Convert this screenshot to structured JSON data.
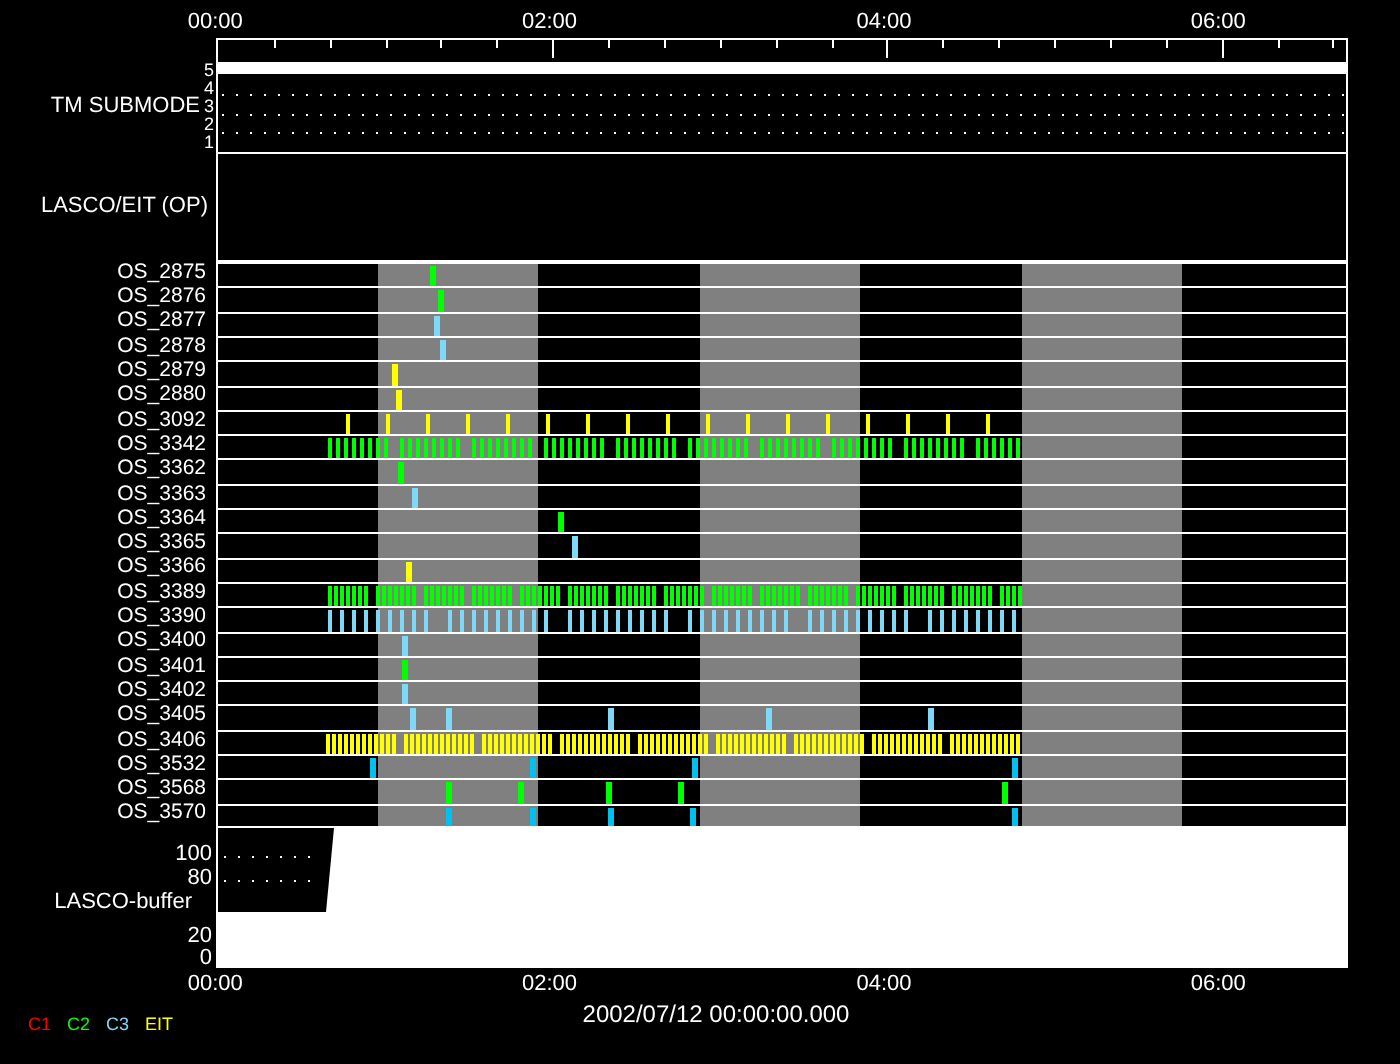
{
  "time_axis_top": [
    "00:00",
    "02:00",
    "04:00",
    "06:00"
  ],
  "tm_submode": {
    "label": "TM SUBMODE",
    "levels": [
      "5",
      "4",
      "3",
      "2",
      "1"
    ]
  },
  "lasco_eit": {
    "label": "LASCO/EIT (OP)"
  },
  "os_rows": [
    {
      "label": "OS_2875",
      "color": "#00ff00"
    },
    {
      "label": "OS_2876",
      "color": "#00ff00"
    },
    {
      "label": "OS_2877",
      "color": "#80d8f8"
    },
    {
      "label": "OS_2878",
      "color": "#80d8f8"
    },
    {
      "label": "OS_2879",
      "color": "#ffff00"
    },
    {
      "label": "OS_2880",
      "color": "#ffff00"
    },
    {
      "label": "OS_3092",
      "color": "#ffff00"
    },
    {
      "label": "OS_3342",
      "color": "#00ff00"
    },
    {
      "label": "OS_3362",
      "color": "#00ff00"
    },
    {
      "label": "OS_3363",
      "color": "#80d8f8"
    },
    {
      "label": "OS_3364",
      "color": "#00ff00"
    },
    {
      "label": "OS_3365",
      "color": "#80d8f8"
    },
    {
      "label": "OS_3366",
      "color": "#ffff00"
    },
    {
      "label": "OS_3389",
      "color": "#00ff00"
    },
    {
      "label": "OS_3390",
      "color": "#80d8f8"
    },
    {
      "label": "OS_3400",
      "color": "#80d8f8"
    },
    {
      "label": "OS_3401",
      "color": "#00ff00"
    },
    {
      "label": "OS_3402",
      "color": "#80d8f8"
    },
    {
      "label": "OS_3405",
      "color": "#80d8f8"
    },
    {
      "label": "OS_3406",
      "color": "#ffff00"
    },
    {
      "label": "OS_3532",
      "color": "#00c0f0"
    },
    {
      "label": "OS_3568",
      "color": "#00ff00"
    },
    {
      "label": "OS_3570",
      "color": "#00c0f0"
    }
  ],
  "buffer": {
    "label": "LASCO-buffer",
    "ticks": [
      "100",
      "80",
      "20",
      "0"
    ]
  },
  "time_axis_bottom": [
    "00:00",
    "02:00",
    "04:00",
    "06:00"
  ],
  "date": "2002/07/12 00:00:00.000",
  "legend": [
    {
      "label": "C1",
      "color": "#ff0000"
    },
    {
      "label": "C2",
      "color": "#00ff00"
    },
    {
      "label": "C3",
      "color": "#80d8f8"
    },
    {
      "label": "EIT",
      "color": "#ffff00"
    }
  ]
}
